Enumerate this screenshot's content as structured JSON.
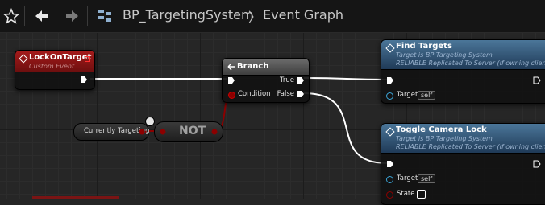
{
  "toolbar": {
    "breadcrumb_blueprint": "BP_TargetingSystem",
    "breadcrumb_separator": "〉",
    "breadcrumb_graph": "Event Graph"
  },
  "colors": {
    "event_header": "#a61b1b",
    "function_header": "#2c4c6e",
    "exec_wire": "#ffffff",
    "boolean_pin": "#8c0000",
    "object_pin": "#3ba5d8"
  },
  "nodes": {
    "lock_on_target": {
      "title": "LockOnTarget",
      "subtitle": "Custom Event"
    },
    "branch": {
      "title": "Branch",
      "true_label": "True",
      "false_label": "False",
      "condition_label": "Condition"
    },
    "currently_targeting": {
      "label": "Currently Targeting"
    },
    "not": {
      "label": "NOT"
    },
    "find_targets": {
      "title": "Find Targets",
      "line1": "Target is BP Targeting System",
      "line2": "RELIABLE Replicated To Server (if owning client)",
      "target_label": "Target",
      "target_value": "self"
    },
    "toggle_camera_lock": {
      "title": "Toggle Camera Lock",
      "line1": "Target is BP Targeting System",
      "line2": "RELIABLE Replicated To Server (if owning client)",
      "target_label": "Target",
      "target_value": "self",
      "state_label": "State"
    }
  }
}
